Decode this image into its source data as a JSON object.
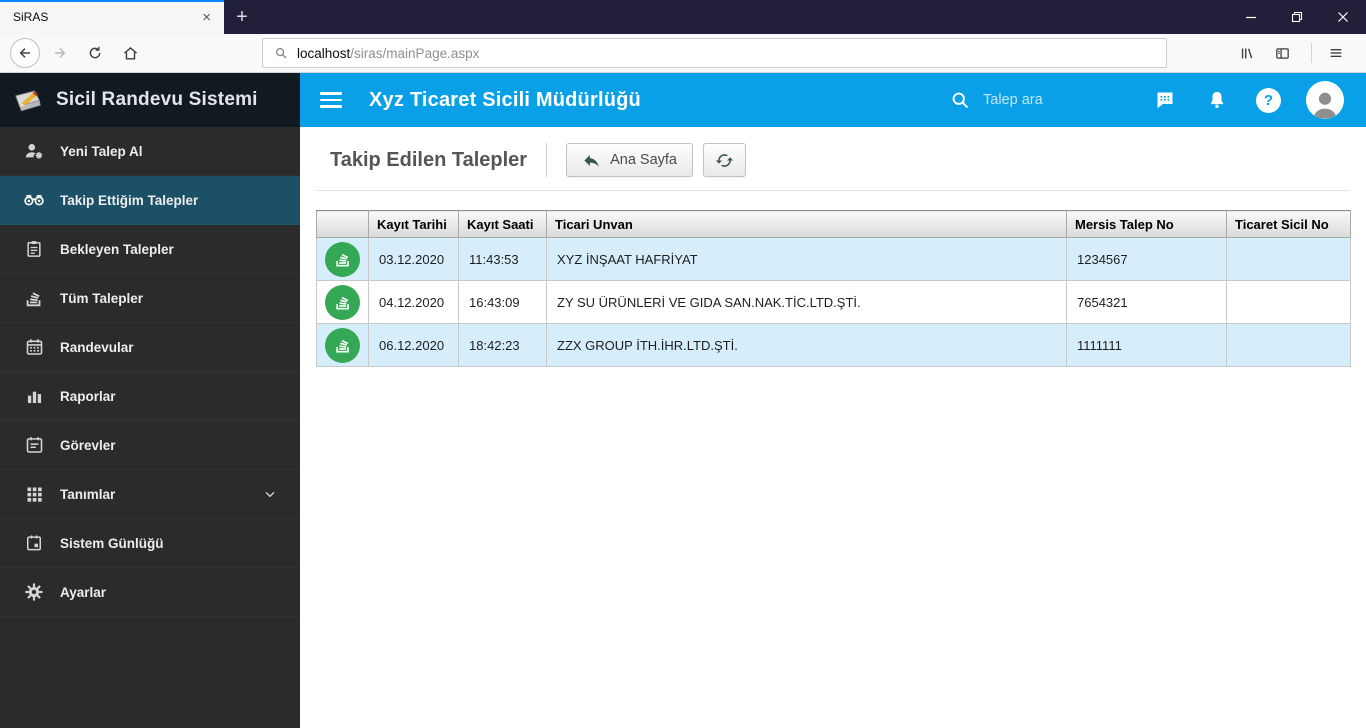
{
  "browser": {
    "tab_title": "SiRAS",
    "url_host": "localhost",
    "url_path": "/siras/mainPage.aspx"
  },
  "glyphs": {
    "close_tab": "×",
    "new_tab": "+",
    "help": "?"
  },
  "sidebar": {
    "logo_text": "Sicil Randevu Sistemi",
    "items": [
      {
        "key": "yeni-talep-al",
        "label": "Yeni Talep Al",
        "icon": "user-gear-icon",
        "active": false,
        "chevron": false
      },
      {
        "key": "takip-ettigim-talepler",
        "label": "Takip Ettiğim Talepler",
        "icon": "binoculars-icon",
        "active": true,
        "chevron": false
      },
      {
        "key": "bekleyen-talepler",
        "label": "Bekleyen Talepler",
        "icon": "clipboard-icon",
        "active": false,
        "chevron": false
      },
      {
        "key": "tum-talepler",
        "label": "Tüm Talepler",
        "icon": "stack-icon",
        "active": false,
        "chevron": false
      },
      {
        "key": "randevular",
        "label": "Randevular",
        "icon": "calendar-icon",
        "active": false,
        "chevron": false
      },
      {
        "key": "raporlar",
        "label": "Raporlar",
        "icon": "bar-chart-icon",
        "active": false,
        "chevron": false
      },
      {
        "key": "gorevler",
        "label": "Görevler",
        "icon": "event-note-icon",
        "active": false,
        "chevron": false
      },
      {
        "key": "tanimlar",
        "label": "Tanımlar",
        "icon": "grid-icon",
        "active": false,
        "chevron": true
      },
      {
        "key": "sistem-gunlugu",
        "label": "Sistem Günlüğü",
        "icon": "calendar-log-icon",
        "active": false,
        "chevron": false
      },
      {
        "key": "ayarlar",
        "label": "Ayarlar",
        "icon": "gear-icon",
        "active": false,
        "chevron": false
      }
    ]
  },
  "header": {
    "title": "Xyz Ticaret Sicili Müdürlüğü",
    "search_placeholder": "Talep ara"
  },
  "main": {
    "page_title": "Takip Edilen Talepler",
    "home_button_label": "Ana Sayfa",
    "table": {
      "columns": [
        "",
        "Kayıt Tarihi",
        "Kayıt Saati",
        "Ticari Unvan",
        "Mersis Talep No",
        "Ticaret Sicil No"
      ],
      "rows": [
        {
          "kayit_tarihi": "03.12.2020",
          "kayit_saati": "11:43:53",
          "ticari_unvan": "XYZ İNŞAAT HAFRİYAT",
          "mersis_talep_no": "1234567",
          "ticaret_sicil_no": "",
          "highlighted": true
        },
        {
          "kayit_tarihi": "04.12.2020",
          "kayit_saati": "16:43:09",
          "ticari_unvan": "ZY SU ÜRÜNLERİ VE GIDA SAN.NAK.TİC.LTD.ŞTİ.",
          "mersis_talep_no": "7654321",
          "ticaret_sicil_no": "",
          "highlighted": false
        },
        {
          "kayit_tarihi": "06.12.2020",
          "kayit_saati": "18:42:23",
          "ticari_unvan": "ZZX GROUP İTH.İHR.LTD.ŞTİ.",
          "mersis_talep_no": "1111111",
          "ticaret_sicil_no": "",
          "highlighted": true
        }
      ]
    }
  },
  "colors": {
    "titlebar_bg": "#211f3a",
    "tab_accent": "#0a84ff",
    "header_blue": "#0aa0e8",
    "sidebar_bg": "#2b2b2b",
    "sidebar_logo_bg": "#101a20",
    "active_item_bg": "#1c5066",
    "row_highlight": "#d6edfb",
    "row_icon_green": "#35a855",
    "button_icon": "#37584e"
  }
}
